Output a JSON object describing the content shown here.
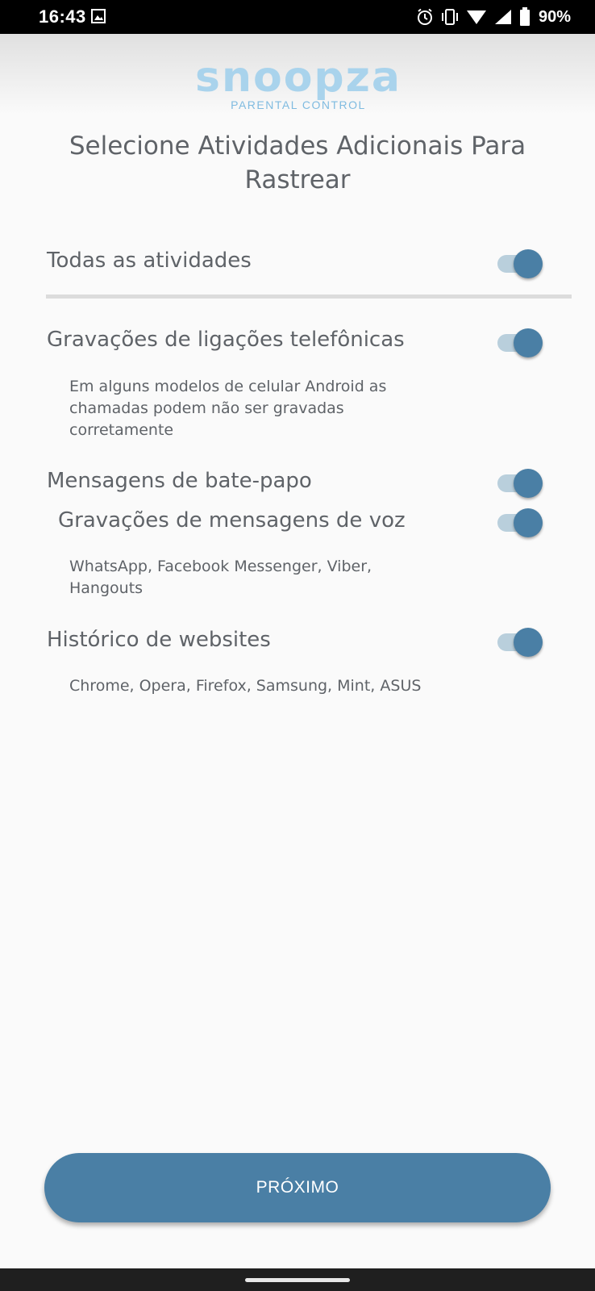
{
  "status_bar": {
    "time": "16:43",
    "battery": "90%",
    "icons": [
      "gallery-icon",
      "alarm-icon",
      "vibrate-icon",
      "wifi-icon",
      "signal-icon",
      "battery-icon"
    ]
  },
  "logo": {
    "wordmark": "snoopza",
    "tagline": "PARENTAL CONTROL",
    "color": "#a9d3ec"
  },
  "title": "Selecione Atividades Adicionais Para Rastrear",
  "settings": {
    "all_activities": {
      "label": "Todas as atividades",
      "enabled": true
    },
    "call_recordings": {
      "label": "Gravações de ligações telefônicas",
      "description": "Em alguns modelos de celular Android as chamadas podem não ser gravadas corretamente",
      "enabled": true
    },
    "chat_messages": {
      "label": "Mensagens de bate-papo",
      "enabled": true
    },
    "voice_messages": {
      "label": "Gravações de mensagens de voz",
      "description": "WhatsApp, Facebook Messenger, Viber, Hangouts",
      "enabled": true
    },
    "website_history": {
      "label": "Histórico de websites",
      "description": "Chrome, Opera, Firefox, Samsung, Mint, ASUS",
      "enabled": true
    }
  },
  "next_button": {
    "label": "PRÓXIMO"
  },
  "colors": {
    "accent": "#4a7fa5",
    "toggle_track": "#b9cfdc",
    "text": "#5f6368",
    "background": "#fafafa"
  }
}
